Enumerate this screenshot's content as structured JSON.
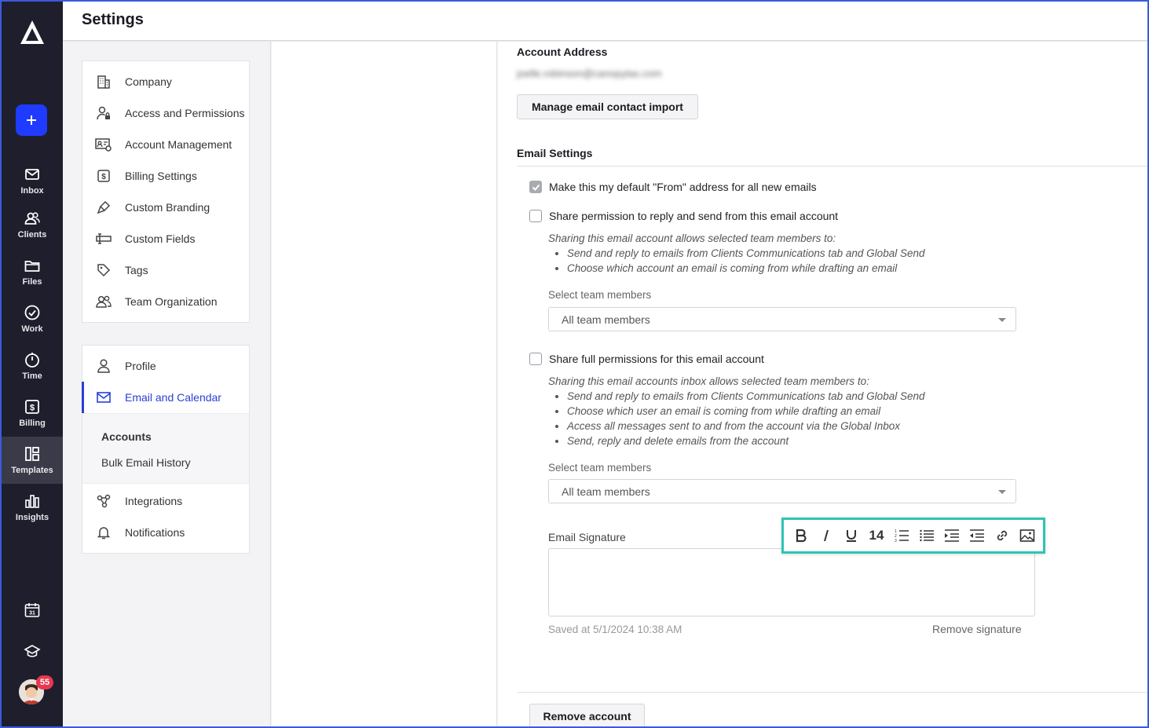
{
  "colors": {
    "accent": "#2a3fd6",
    "nav_bg": "#1e1e2d",
    "add_button": "#1f3bff",
    "highlight": "#2ec4b6",
    "badge": "#e8384f"
  },
  "app": {
    "page_title": "Settings"
  },
  "left_nav": {
    "items": [
      {
        "label": "Inbox",
        "icon": "mail-icon"
      },
      {
        "label": "Clients",
        "icon": "users-icon"
      },
      {
        "label": "Files",
        "icon": "folder-icon"
      },
      {
        "label": "Work",
        "icon": "check-circle-icon"
      },
      {
        "label": "Time",
        "icon": "timer-icon"
      },
      {
        "label": "Billing",
        "icon": "dollar-icon"
      },
      {
        "label": "Templates",
        "icon": "templates-icon"
      },
      {
        "label": "Insights",
        "icon": "bar-chart-icon"
      }
    ],
    "calendar_day": "31",
    "notification_count": "55"
  },
  "settings_menu": {
    "firm": [
      {
        "label": "Company",
        "icon": "building-icon"
      },
      {
        "label": "Access and Permissions",
        "icon": "user-lock-icon"
      },
      {
        "label": "Account Management",
        "icon": "id-card-gear-icon"
      },
      {
        "label": "Billing Settings",
        "icon": "dollar-icon"
      },
      {
        "label": "Custom Branding",
        "icon": "brush-icon"
      },
      {
        "label": "Custom Fields",
        "icon": "form-field-icon"
      },
      {
        "label": "Tags",
        "icon": "tag-icon"
      },
      {
        "label": "Team Organization",
        "icon": "team-icon"
      }
    ],
    "personal": [
      {
        "label": "Profile",
        "icon": "person-icon"
      },
      {
        "label": "Email and Calendar",
        "icon": "mail-icon"
      }
    ],
    "sub": [
      {
        "label": "Accounts"
      },
      {
        "label": "Bulk Email History"
      }
    ],
    "more": [
      {
        "label": "Integrations",
        "icon": "integrations-icon"
      },
      {
        "label": "Notifications",
        "icon": "bell-icon"
      }
    ]
  },
  "content": {
    "account_address_title": "Account Address",
    "account_address_value": "joelle.robinson@canopytax.com",
    "manage_import_button": "Manage email contact import",
    "email_settings_title": "Email Settings",
    "default_from_label": "Make this my default \"From\" address for all new emails",
    "default_from_checked": true,
    "share_reply": {
      "label": "Share permission to reply and send from this email account",
      "checked": false,
      "intro": "Sharing this email account allows selected team members to:",
      "bullets": [
        "Send and reply to emails from Clients Communications tab and Global Send",
        "Choose which account an email is coming from while drafting an email"
      ],
      "select_label": "Select team members",
      "select_value": "All team members"
    },
    "share_full": {
      "label": "Share full permissions for this email account",
      "checked": false,
      "intro": "Sharing this email accounts inbox allows selected team members to:",
      "bullets": [
        "Send and reply to emails from Clients Communications tab and Global Send",
        "Choose which user an email is coming from while drafting an email",
        "Access all messages sent to and from the account via the Global Inbox",
        "Send, reply and delete emails from the account"
      ],
      "select_label": "Select team members",
      "select_value": "All team members"
    },
    "signature": {
      "label": "Email Signature",
      "font_size": "14",
      "saved_text": "Saved at 5/1/2024 10:38 AM",
      "remove_label": "Remove signature"
    },
    "remove_account_button": "Remove account"
  }
}
